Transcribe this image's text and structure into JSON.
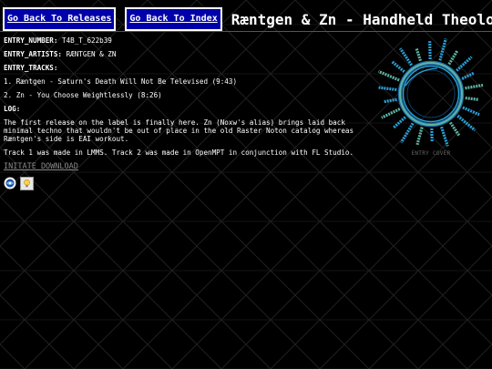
{
  "nav": {
    "back_releases": "Go Back To Releases",
    "back_index": "Go Back To Index"
  },
  "page_title": "Ræntgen & Zn - Handheld Theology",
  "entry": {
    "number_label": "ENTRY_NUMBER:",
    "number_value": "T4B_T_622b39",
    "artists_label": "ENTRY_ARTISTS:",
    "artists_value": "RÆNTGEN & ZN",
    "tracks_label": "ENTRY_TRACKS:",
    "tracks": [
      "1. Ræntgen - Saturn's Death Will Not Be Televised (9:43)",
      "2. Zn - You Choose Weightlessly (8:26)"
    ],
    "log_label": "LOG:",
    "log_paragraphs": [
      "The first release on the label is finally here. Zn (Noxw's alias) brings laid back minimal techno that wouldn't be out of place in the old Raster Noton catalog whereas Ræntgen's side is EAI workout.",
      "Track 1 was made in LMMS. Track 2 was made in OpenMPT in conjunction with FL Studio."
    ],
    "download_label": "INITATE_DOWNLOAD"
  },
  "badges": [
    "globe-badge-icon",
    "lightbulb-badge-icon"
  ],
  "cover": {
    "caption": "ENTRY COVER"
  },
  "colors": {
    "button_bg": "#0000aa",
    "accent_blue": "#2a9fd6",
    "ring_teal": "#5fb3a3",
    "link_gray": "#8a8a8a"
  }
}
